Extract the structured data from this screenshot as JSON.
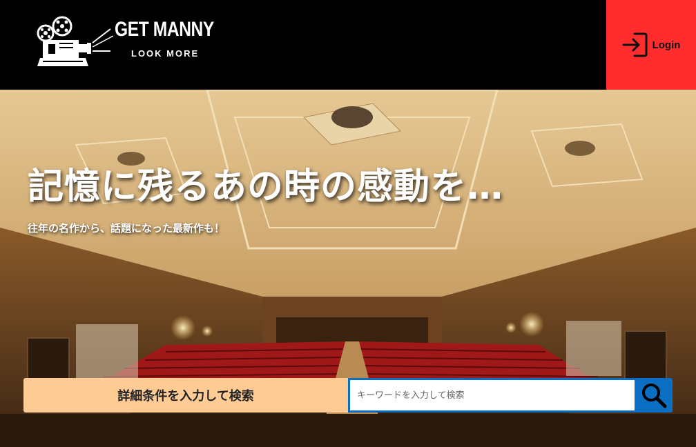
{
  "header": {
    "logo_title": "GET MANNY",
    "logo_subtitle": "LOOK MORE",
    "login_label": "Login"
  },
  "hero": {
    "headline": "記憶に残るあの時の感動を…",
    "subheadline": "往年の名作から、話題になった最新作も！"
  },
  "search": {
    "detail_button_label": "詳細条件を入力して検索",
    "keyword_placeholder": "キーワードを入力して検索",
    "keyword_value": ""
  },
  "colors": {
    "header_bg": "#000000",
    "login_bg": "#ff2d2d",
    "detail_button_bg": "#ffcb95",
    "search_accent": "#0a6fc2"
  },
  "icons": {
    "logo": "film-projector-icon",
    "login": "login-icon",
    "search": "search-icon"
  }
}
